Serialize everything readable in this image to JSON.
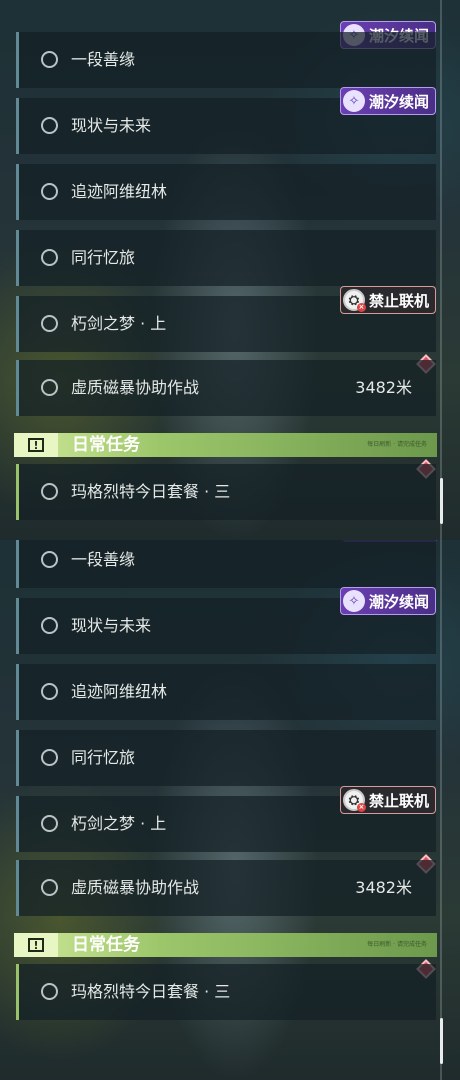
{
  "quests": {
    "q1": "一段善缘",
    "q2": "现状与未来",
    "q3": "追迹阿维纽林",
    "q4": "同行忆旅",
    "q5": "朽剑之梦 · 上",
    "q6": "虚质磁暴协助作战",
    "q6_distance": "3482米"
  },
  "daily": {
    "title": "日常任务",
    "subtitle": "每日刷新 · 请完成任务",
    "quest": "玛格烈特今日套餐 · 三"
  },
  "badges": {
    "tide": "潮汐续闻",
    "no_coop": "禁止联机"
  },
  "colors": {
    "accent_daily": "#9ac26a",
    "tide_badge": "#6b3fb3",
    "marker": "#e04a5e"
  },
  "icons": [
    "circle-icon",
    "tide-icon",
    "no-coop-icon",
    "diamond-marker-icon",
    "daily-quest-icon"
  ]
}
